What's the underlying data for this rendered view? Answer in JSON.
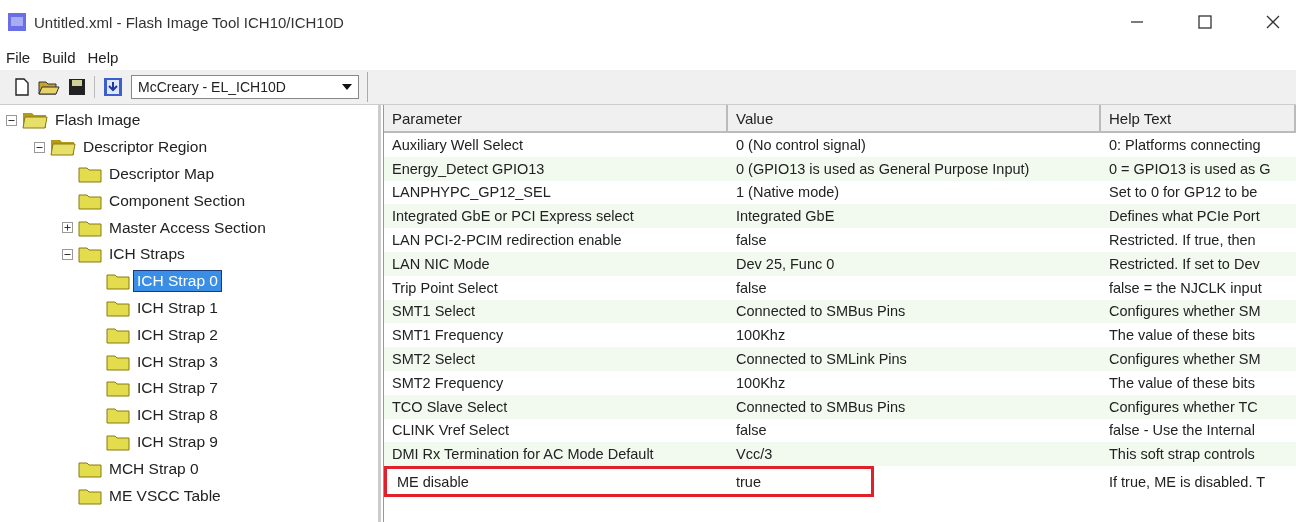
{
  "window": {
    "title": "Untitled.xml - Flash Image Tool  ICH10/ICH10D"
  },
  "menu": [
    "File",
    "Build",
    "Help"
  ],
  "toolbar": {
    "platform": "McCreary - EL_ICH10D"
  },
  "tree": [
    {
      "label": "Flash Image",
      "kind": "root",
      "expanded": true,
      "selected": false,
      "children": [
        {
          "label": "Descriptor Region",
          "kind": "root",
          "expanded": true,
          "selected": false,
          "children": [
            {
              "label": "Descriptor Map",
              "kind": "folder",
              "selected": false
            },
            {
              "label": "Component Section",
              "kind": "folder",
              "selected": false
            },
            {
              "label": "Master Access Section",
              "kind": "folder",
              "expanded": false,
              "selected": false
            },
            {
              "label": "ICH Straps",
              "kind": "folder",
              "expanded": true,
              "selected": false,
              "children": [
                {
                  "label": "ICH Strap 0",
                  "kind": "folder",
                  "selected": true
                },
                {
                  "label": "ICH Strap 1",
                  "kind": "folder",
                  "selected": false
                },
                {
                  "label": "ICH Strap 2",
                  "kind": "folder",
                  "selected": false
                },
                {
                  "label": "ICH Strap 3",
                  "kind": "folder",
                  "selected": false
                },
                {
                  "label": "ICH Strap 7",
                  "kind": "folder",
                  "selected": false
                },
                {
                  "label": "ICH Strap 8",
                  "kind": "folder",
                  "selected": false
                },
                {
                  "label": "ICH Strap 9",
                  "kind": "folder",
                  "selected": false
                }
              ]
            },
            {
              "label": "MCH Strap 0",
              "kind": "folder",
              "selected": false
            },
            {
              "label": "ME VSCC Table",
              "kind": "folder",
              "selected": false
            }
          ]
        }
      ]
    }
  ],
  "table": {
    "columns": [
      "Parameter",
      "Value",
      "Help Text"
    ],
    "rows": [
      {
        "parameter": "Auxiliary Well Select",
        "value": "0 (No control signal)",
        "help": "0: Platforms connecting",
        "highlighted": false
      },
      {
        "parameter": "Energy_Detect GPIO13",
        "value": "0 (GPIO13 is used as General Purpose Input)",
        "help": "0 = GPIO13 is used as G",
        "highlighted": false
      },
      {
        "parameter": "LANPHYPC_GP12_SEL",
        "value": "1 (Native mode)",
        "help": "Set to 0 for GP12 to be",
        "highlighted": false
      },
      {
        "parameter": "Integrated GbE or PCI Express select",
        "value": "Integrated GbE",
        "help": "Defines what PCIe Port",
        "highlighted": false
      },
      {
        "parameter": "LAN PCI-2-PCIM redirection enable",
        "value": "false",
        "help": "Restricted. If true, then",
        "highlighted": false
      },
      {
        "parameter": "LAN NIC Mode",
        "value": "Dev 25, Func 0",
        "help": "Restricted. If set to Dev",
        "highlighted": false
      },
      {
        "parameter": "Trip Point Select",
        "value": "false",
        "help": "false = the NJCLK input",
        "highlighted": false
      },
      {
        "parameter": "SMT1 Select",
        "value": "Connected to SMBus Pins",
        "help": "Configures whether SM",
        "highlighted": false
      },
      {
        "parameter": "SMT1 Frequency",
        "value": "100Khz",
        "help": "The value of these bits",
        "highlighted": false
      },
      {
        "parameter": "SMT2 Select",
        "value": "Connected to SMLink Pins",
        "help": "Configures whether SM",
        "highlighted": false
      },
      {
        "parameter": "SMT2 Frequency",
        "value": "100Khz",
        "help": "The value of these bits",
        "highlighted": false
      },
      {
        "parameter": "TCO Slave Select",
        "value": "Connected to SMBus Pins",
        "help": "Configures whether TC",
        "highlighted": false
      },
      {
        "parameter": "CLINK Vref Select",
        "value": "false",
        "help": "false - Use the Internal",
        "highlighted": false
      },
      {
        "parameter": "DMI Rx Termination for AC Mode Default",
        "value": "Vcc/3",
        "help": "This soft strap controls",
        "highlighted": false
      },
      {
        "parameter": "ME disable",
        "value": "true",
        "help": "If true, ME is disabled. T",
        "highlighted": true
      }
    ]
  }
}
